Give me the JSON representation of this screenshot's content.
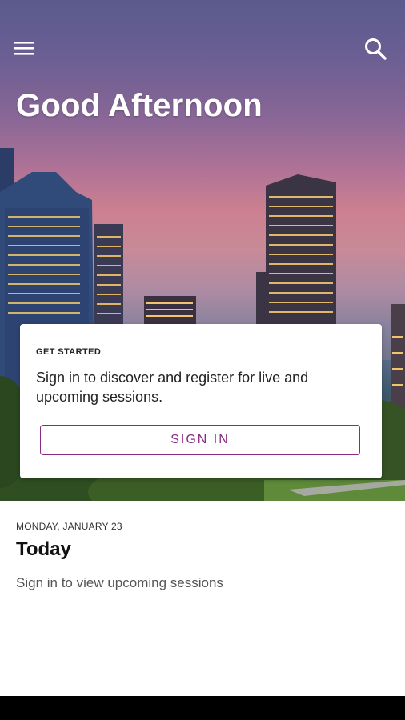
{
  "header": {
    "menu_icon": "hamburger-menu-icon",
    "search_icon": "search-icon",
    "greeting": "Good Afternoon"
  },
  "get_started_card": {
    "eyebrow": "GET STARTED",
    "message": "Sign in to discover and register for live and upcoming sessions.",
    "sign_in_label": "SIGN IN"
  },
  "today": {
    "date": "MONDAY, JANUARY 23",
    "title": "Today",
    "message": "Sign in to view upcoming sessions"
  },
  "colors": {
    "accent": "#8a2a86",
    "text_primary": "#222222",
    "text_secondary": "#555555"
  }
}
